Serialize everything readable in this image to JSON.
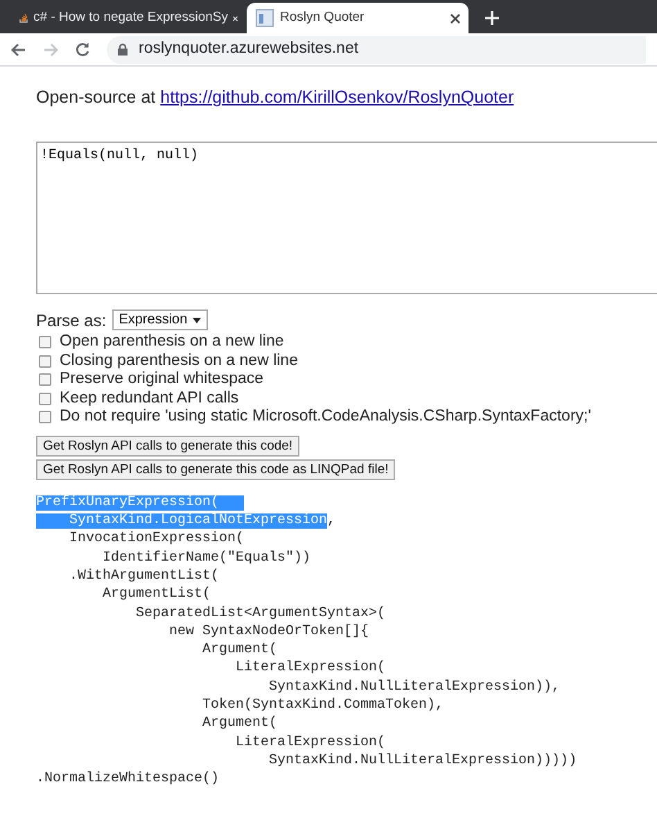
{
  "tabs": [
    {
      "title": "c# - How to negate ExpressionSy",
      "selected": false,
      "kind": "so"
    },
    {
      "title": "Roslyn Quoter",
      "selected": true,
      "kind": "doc"
    }
  ],
  "address_bar": {
    "url": "roslynquoter.azurewebsites.net"
  },
  "intro": {
    "text": "Open-source at",
    "link": "https://github.com/KirillOsenkov/RoslynQuoter"
  },
  "source_input": {
    "value": "!Equals(null, null)"
  },
  "parse_as": {
    "label": "Parse as:",
    "value": "Expression"
  },
  "options": [
    {
      "label": "Open parenthesis on a new line",
      "checked": false
    },
    {
      "label": "Closing parenthesis on a new line",
      "checked": false
    },
    {
      "label": "Preserve original whitespace",
      "checked": false
    },
    {
      "label": "Keep redundant API calls",
      "checked": false
    },
    {
      "label": "Do not require 'using static Microsoft.CodeAnalysis.CSharp.SyntaxFactory;'",
      "checked": false
    }
  ],
  "buttons": [
    "Get Roslyn API calls to generate this code!",
    "Get Roslyn API calls to generate this code as LINQPad file!"
  ],
  "output_lines": [
    [
      {
        "text": "PrefixUnaryExpression(   ",
        "highlighted": true
      }
    ],
    [
      {
        "text": "    SyntaxKind.LogicalNotExpression",
        "highlighted": true
      },
      {
        "text": ",",
        "highlighted": false
      }
    ],
    [
      {
        "text": "    InvocationExpression(",
        "highlighted": false
      }
    ],
    [
      {
        "text": "        IdentifierName(\"Equals\"))",
        "highlighted": false
      }
    ],
    [
      {
        "text": "    .WithArgumentList(",
        "highlighted": false
      }
    ],
    [
      {
        "text": "        ArgumentList(",
        "highlighted": false
      }
    ],
    [
      {
        "text": "            SeparatedList<ArgumentSyntax>(",
        "highlighted": false
      }
    ],
    [
      {
        "text": "                new SyntaxNodeOrToken[]{",
        "highlighted": false
      }
    ],
    [
      {
        "text": "                    Argument(",
        "highlighted": false
      }
    ],
    [
      {
        "text": "                        LiteralExpression(",
        "highlighted": false
      }
    ],
    [
      {
        "text": "                            SyntaxKind.NullLiteralExpression)),",
        "highlighted": false
      }
    ],
    [
      {
        "text": "                    Token(SyntaxKind.CommaToken),",
        "highlighted": false
      }
    ],
    [
      {
        "text": "                    Argument(",
        "highlighted": false
      }
    ],
    [
      {
        "text": "                        LiteralExpression(",
        "highlighted": false
      }
    ],
    [
      {
        "text": "                            SyntaxKind.NullLiteralExpression)))))",
        "highlighted": false
      }
    ],
    [
      {
        "text": ".NormalizeWhitespace()",
        "highlighted": false
      }
    ]
  ]
}
